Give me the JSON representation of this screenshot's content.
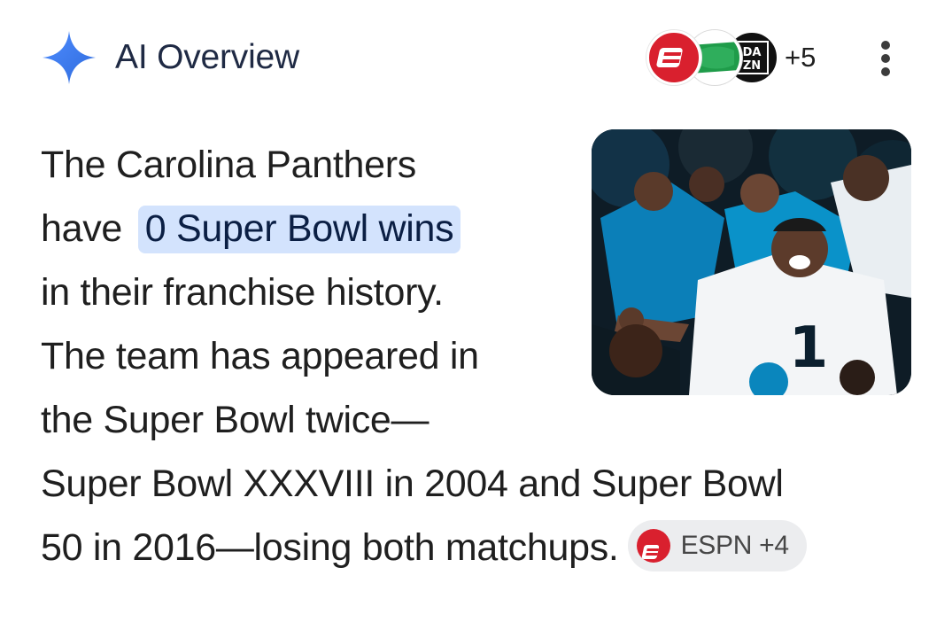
{
  "header": {
    "title": "AI Overview",
    "sparkle_icon": "gemini-sparkle-icon",
    "sparkle_color": "#4285f4",
    "sources": [
      {
        "icon": "espn-logo-icon",
        "color": "#d9202e"
      },
      {
        "icon": "green-source-logo-icon",
        "color": "#1f9c4a"
      },
      {
        "icon": "dazn-logo-icon",
        "color": "#111111"
      }
    ],
    "extra_sources": "+5",
    "menu_icon": "more-vert-icon"
  },
  "answer": {
    "line1": "The Carolina Panthers",
    "line2_prefix": "have",
    "highlight": "0 Super Bowl wins",
    "line3": "in their franchise history.",
    "line4": "The team has appeared in",
    "line5": "the Super Bowl twice—",
    "line6": "Super Bowl XXXVIII in 2004 and Super Bowl",
    "line7": "50 in 2016—losing both matchups."
  },
  "citation": {
    "source": "ESPN",
    "extra": "+4",
    "icon": "espn-logo-icon"
  },
  "image": {
    "subject": "carolina-panthers-players-celebrating"
  },
  "colors": {
    "highlight_bg": "#d3e3fd",
    "panthers_blue": "#0085ca",
    "espn_red": "#d9202e"
  }
}
